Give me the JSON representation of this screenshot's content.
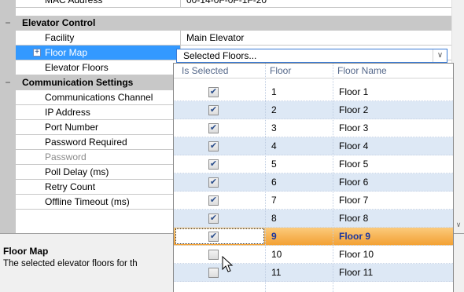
{
  "top_partial": {
    "label": "MAC Address",
    "value": "00-14-0F-0F-1F-20"
  },
  "categories": {
    "elevator": {
      "toggle": "−",
      "label": "Elevator Control"
    },
    "communication": {
      "toggle": "−",
      "label": "Communication Settings"
    }
  },
  "elevator_props": {
    "facility": {
      "label": "Facility",
      "value": "Main Elevator"
    },
    "floor_map": {
      "expander": "+",
      "label": "Floor Map",
      "value": "Selected Floors..."
    },
    "elevator_floors": {
      "label": "Elevator Floors"
    }
  },
  "comm_props": [
    {
      "label": "Communications Channel"
    },
    {
      "label": "IP Address"
    },
    {
      "label": "Port Number"
    },
    {
      "label": "Password Required"
    },
    {
      "label": "Password"
    },
    {
      "label": "Poll Delay (ms)"
    },
    {
      "label": "Retry Count"
    },
    {
      "label": "Offline Timeout (ms)"
    }
  ],
  "help": {
    "title": "Floor Map",
    "description": "The selected elevator floors for th"
  },
  "dropdown": {
    "arrow": "∨",
    "columns": [
      "Is Selected",
      "Floor",
      "Floor Name"
    ],
    "rows": [
      {
        "selected": true,
        "floor": "1",
        "name": "Floor 1"
      },
      {
        "selected": true,
        "floor": "2",
        "name": "Floor 2"
      },
      {
        "selected": true,
        "floor": "3",
        "name": "Floor 3"
      },
      {
        "selected": true,
        "floor": "4",
        "name": "Floor 4"
      },
      {
        "selected": true,
        "floor": "5",
        "name": "Floor 5"
      },
      {
        "selected": true,
        "floor": "6",
        "name": "Floor 6"
      },
      {
        "selected": true,
        "floor": "7",
        "name": "Floor 7"
      },
      {
        "selected": true,
        "floor": "8",
        "name": "Floor 8"
      },
      {
        "selected": true,
        "floor": "9",
        "name": "Floor 9"
      },
      {
        "selected": false,
        "floor": "10",
        "name": "Floor 10"
      },
      {
        "selected": false,
        "floor": "11",
        "name": "Floor 11"
      }
    ],
    "check_glyph": "✔"
  },
  "scrollbar": {
    "down_arrow": "∨"
  },
  "colors": {
    "selection": "#3399ff",
    "category_bg": "#c8c8c8",
    "row_alt": "#dde8f5",
    "row_hover": "#f3a134",
    "active_text": "#1a35a0"
  }
}
